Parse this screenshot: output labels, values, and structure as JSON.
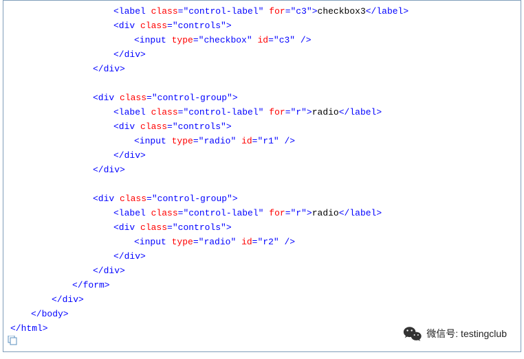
{
  "code": {
    "l1": {
      "tag_open": "<label ",
      "attr1_name": "class",
      "attr1_val": "\"control-label\"",
      "attr2_name": "for",
      "attr2_val": "\"c3\"",
      "tag_mid": ">",
      "text": "checkbox3",
      "tag_close": "</label>"
    },
    "l2": {
      "tag_open": "<div ",
      "attr1_name": "class",
      "attr1_val": "\"controls\"",
      "tag_close": ">"
    },
    "l3": {
      "tag_open": "<input ",
      "attr1_name": "type",
      "attr1_val": "\"checkbox\"",
      "attr2_name": "id",
      "attr2_val": "\"c3\"",
      "tag_close": " />"
    },
    "l4": {
      "tag": "</div>"
    },
    "l5": {
      "tag": "</div>"
    },
    "l6": {
      "tag_open": "<div ",
      "attr1_name": "class",
      "attr1_val": "\"control-group\"",
      "tag_close": ">"
    },
    "l7": {
      "tag_open": "<label ",
      "attr1_name": "class",
      "attr1_val": "\"control-label\"",
      "attr2_name": "for",
      "attr2_val": "\"r\"",
      "tag_mid": ">",
      "text": "radio",
      "tag_close": "</label>"
    },
    "l8": {
      "tag_open": "<div ",
      "attr1_name": "class",
      "attr1_val": "\"controls\"",
      "tag_close": ">"
    },
    "l9": {
      "tag_open": "<input ",
      "attr1_name": "type",
      "attr1_val": "\"radio\"",
      "attr2_name": "id",
      "attr2_val": "\"r1\"",
      "tag_close": " />"
    },
    "l10": {
      "tag": "</div>"
    },
    "l11": {
      "tag": "</div>"
    },
    "l12": {
      "tag_open": "<div ",
      "attr1_name": "class",
      "attr1_val": "\"control-group\"",
      "tag_close": ">"
    },
    "l13": {
      "tag_open": "<label ",
      "attr1_name": "class",
      "attr1_val": "\"control-label\"",
      "attr2_name": "for",
      "attr2_val": "\"r\"",
      "tag_mid": ">",
      "text": "radio",
      "tag_close": "</label>"
    },
    "l14": {
      "tag_open": "<div ",
      "attr1_name": "class",
      "attr1_val": "\"controls\"",
      "tag_close": ">"
    },
    "l15": {
      "tag_open": "<input ",
      "attr1_name": "type",
      "attr1_val": "\"radio\"",
      "attr2_name": "id",
      "attr2_val": "\"r2\"",
      "tag_close": " />"
    },
    "l16": {
      "tag": "</div>"
    },
    "l17": {
      "tag": "</div>"
    },
    "l18": {
      "tag": "</form>"
    },
    "l19": {
      "tag": "</div>"
    },
    "l20": {
      "tag": "</body>"
    },
    "l21": {
      "tag": "</html>"
    }
  },
  "badge": {
    "text": "微信号: testingclub"
  }
}
